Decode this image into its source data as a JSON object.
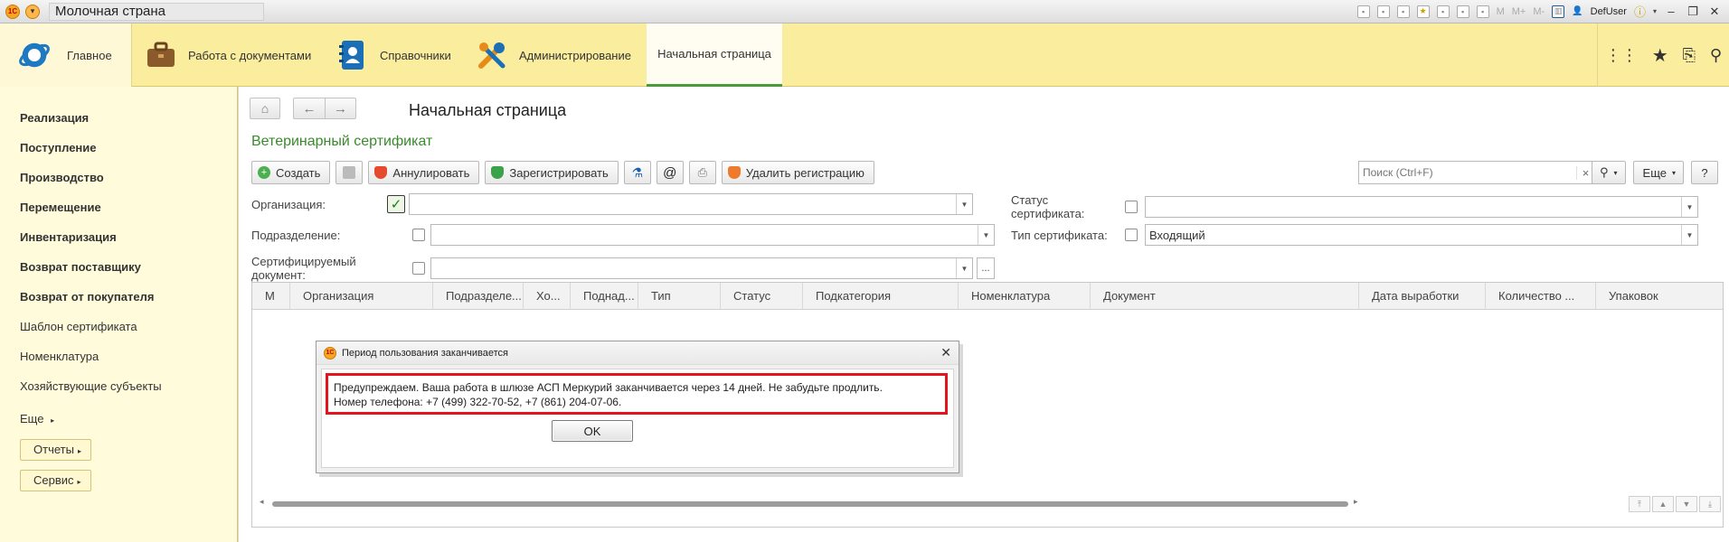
{
  "window": {
    "title": "Молочная страна",
    "user": "DefUser",
    "memory_buttons": [
      "M",
      "M+",
      "M-"
    ]
  },
  "sections": {
    "main": "Главное",
    "documents": "Работа с документами",
    "references": "Справочники",
    "admin": "Администрирование",
    "home": "Начальная страница"
  },
  "sidebar": {
    "items": [
      {
        "label": "Реализация",
        "bold": true
      },
      {
        "label": "Поступление",
        "bold": true
      },
      {
        "label": "Производство",
        "bold": true
      },
      {
        "label": "Перемещение",
        "bold": true
      },
      {
        "label": "Инвентаризация",
        "bold": true
      },
      {
        "label": "Возврат поставщику",
        "bold": true
      },
      {
        "label": "Возврат от покупателя",
        "bold": true
      },
      {
        "label": "Шаблон сертификата",
        "bold": false
      },
      {
        "label": "Номенклатура",
        "bold": false
      },
      {
        "label": "Хозяйствующие субъекты",
        "bold": false
      }
    ],
    "more": "Еще",
    "reports": "Отчеты",
    "service": "Сервис"
  },
  "page": {
    "title": "Начальная страница",
    "form_title": "Ветеринарный сертификат"
  },
  "toolbar": {
    "create": "Создать",
    "annul": "Аннулировать",
    "register": "Зарегистрировать",
    "at": "@",
    "delete_registration": "Удалить регистрацию",
    "more": "Еще",
    "help": "?"
  },
  "search": {
    "placeholder": "Поиск (Ctrl+F)",
    "clear": "×"
  },
  "filters": {
    "organization": {
      "label": "Организация:",
      "checked": true,
      "value": ""
    },
    "department": {
      "label": "Подразделение:",
      "checked": false,
      "value": ""
    },
    "cert_document": {
      "label": "Сертифицируемый документ:",
      "checked": false,
      "value": ""
    },
    "cert_status": {
      "label": "Статус сертификата:",
      "checked": false,
      "value": ""
    },
    "cert_type": {
      "label": "Тип сертификата:",
      "checked": false,
      "value": "Входящий"
    }
  },
  "table": {
    "columns": [
      "М",
      "Организация",
      "Подразделе...",
      "Хо...",
      "Поднад...",
      "Тип",
      "Статус",
      "Подкатегория",
      "Номенклатура",
      "Документ",
      "Дата выработки",
      "Количество ...",
      "Упаковок"
    ],
    "rows": []
  },
  "dialog": {
    "title": "Период пользования заканчивается",
    "line1": "Предупреждаем. Ваша работа в шлюзе АСП Меркурий заканчивается через 14 дней. Не забудьте продлить.",
    "line2": "Номер телефона: +7 (499) 322-70-52, +7 (861) 204-07-06.",
    "ok": "OK"
  }
}
